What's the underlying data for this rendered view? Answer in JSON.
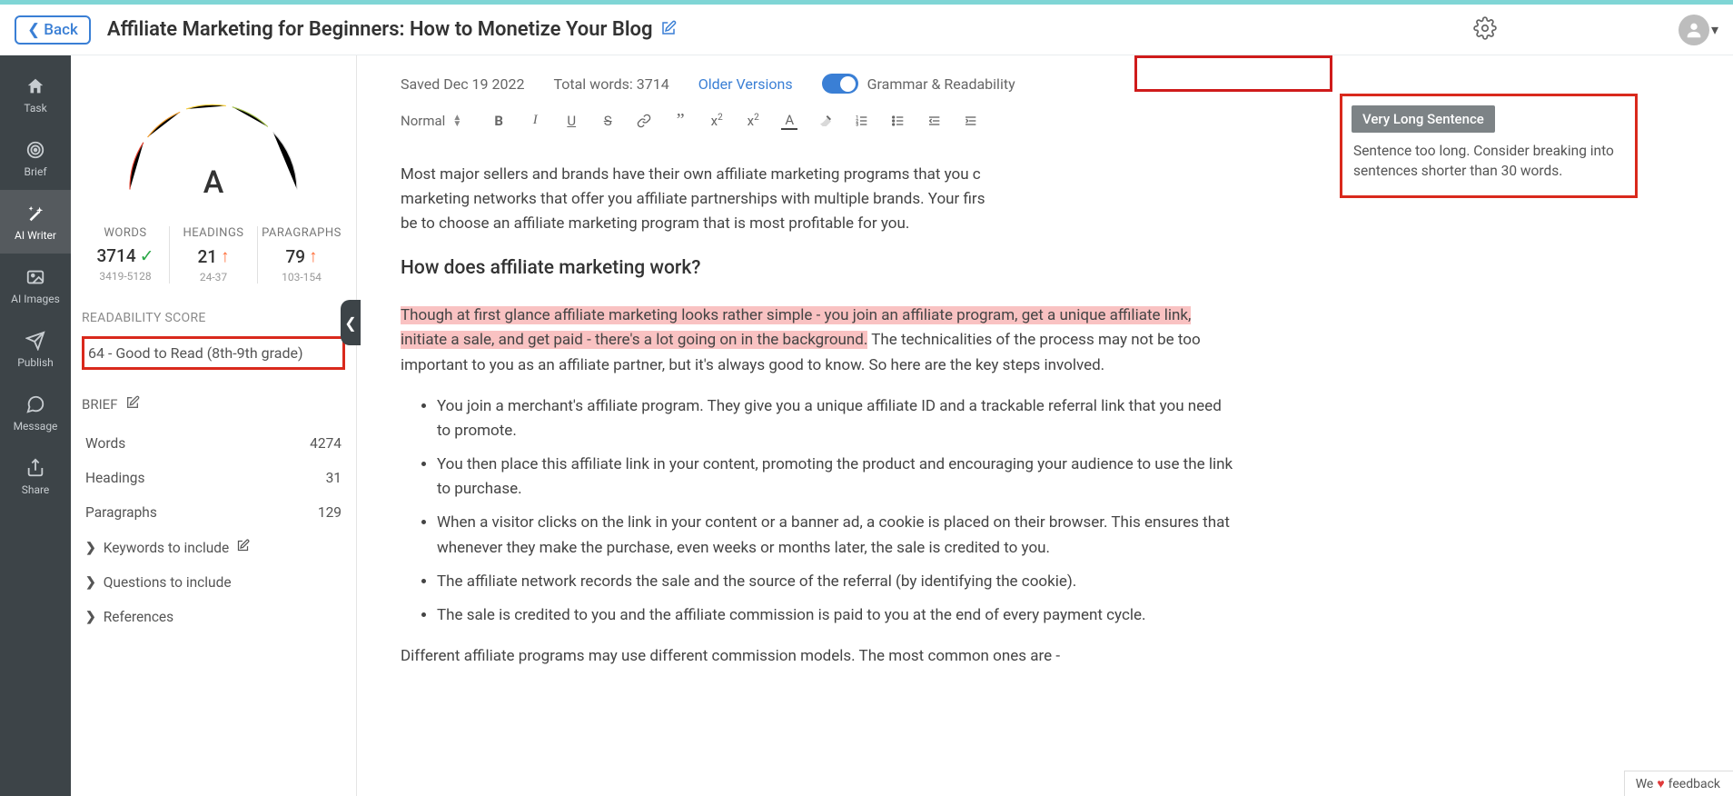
{
  "header": {
    "back": "Back",
    "title": "Affiliate Marketing for Beginners: How to Monetize Your Blog"
  },
  "nav": {
    "task": "Task",
    "brief": "Brief",
    "aiwriter": "AI Writer",
    "aiimages": "AI Images",
    "publish": "Publish",
    "message": "Message",
    "share": "Share"
  },
  "gauge": {
    "letter": "A"
  },
  "stats": {
    "words": {
      "label": "WORDS",
      "value": "3714",
      "range": "3419-5128"
    },
    "headings": {
      "label": "HEADINGS",
      "value": "21",
      "range": "24-37"
    },
    "paragraphs": {
      "label": "PARAGRAPHS",
      "value": "79",
      "range": "103-154"
    }
  },
  "readability": {
    "label": "READABILITY SCORE",
    "value": "64 - Good to Read (8th-9th grade)"
  },
  "brief": {
    "label": "BRIEF",
    "words_label": "Words",
    "words_val": "4274",
    "headings_label": "Headings",
    "headings_val": "31",
    "paragraphs_label": "Paragraphs",
    "paragraphs_val": "129",
    "keywords": "Keywords to include",
    "questions": "Questions to include",
    "references": "References"
  },
  "editor": {
    "saved": "Saved Dec 19 2022",
    "total": "Total words: 3714",
    "older": "Older Versions",
    "grammar_label": "Grammar & Readability",
    "format": "Normal"
  },
  "tooltip": {
    "head": "Very Long Sentence",
    "body": "Sentence too long. Consider breaking into sentences shorter than 30 words."
  },
  "content": {
    "p1a": "Most major sellers and brands have their own affiliate marketing programs that you c",
    "p1b": "marketing networks that offer you affiliate partnerships with multiple brands. Your firs",
    "p1c": "be to choose an affiliate marketing program that is most profitable for you.",
    "h3": "How does affiliate marketing work?",
    "hl": "Though at first glance affiliate marketing looks rather simple - you join an affiliate program, get a unique affiliate link, initiate a sale, and get paid - there's a lot going on in the background.",
    "p2b": " The technicalities of the process may not be too important to you as an affiliate partner, but it's always good to know. So here are the key steps involved.",
    "li1": "You join a merchant's affiliate program. They give you a unique affiliate ID and a trackable referral link that you need to promote.",
    "li2": "You then place this affiliate link in your content, promoting the product and encouraging your audience to use the link to purchase.",
    "li3": "When a visitor clicks on the link in your content or a banner ad, a cookie is placed on their browser. This ensures that whenever they make the purchase, even weeks or months later, the sale is credited to you.",
    "li4": "The affiliate network records the sale and the source of the referral (by identifying the cookie).",
    "li5": "The sale is credited to you and the affiliate commission is paid to you at the end of every payment cycle.",
    "p3": "Different affiliate programs may use different commission models. The most common ones are -"
  },
  "feedback": {
    "pre": "We",
    "post": "feedback"
  }
}
